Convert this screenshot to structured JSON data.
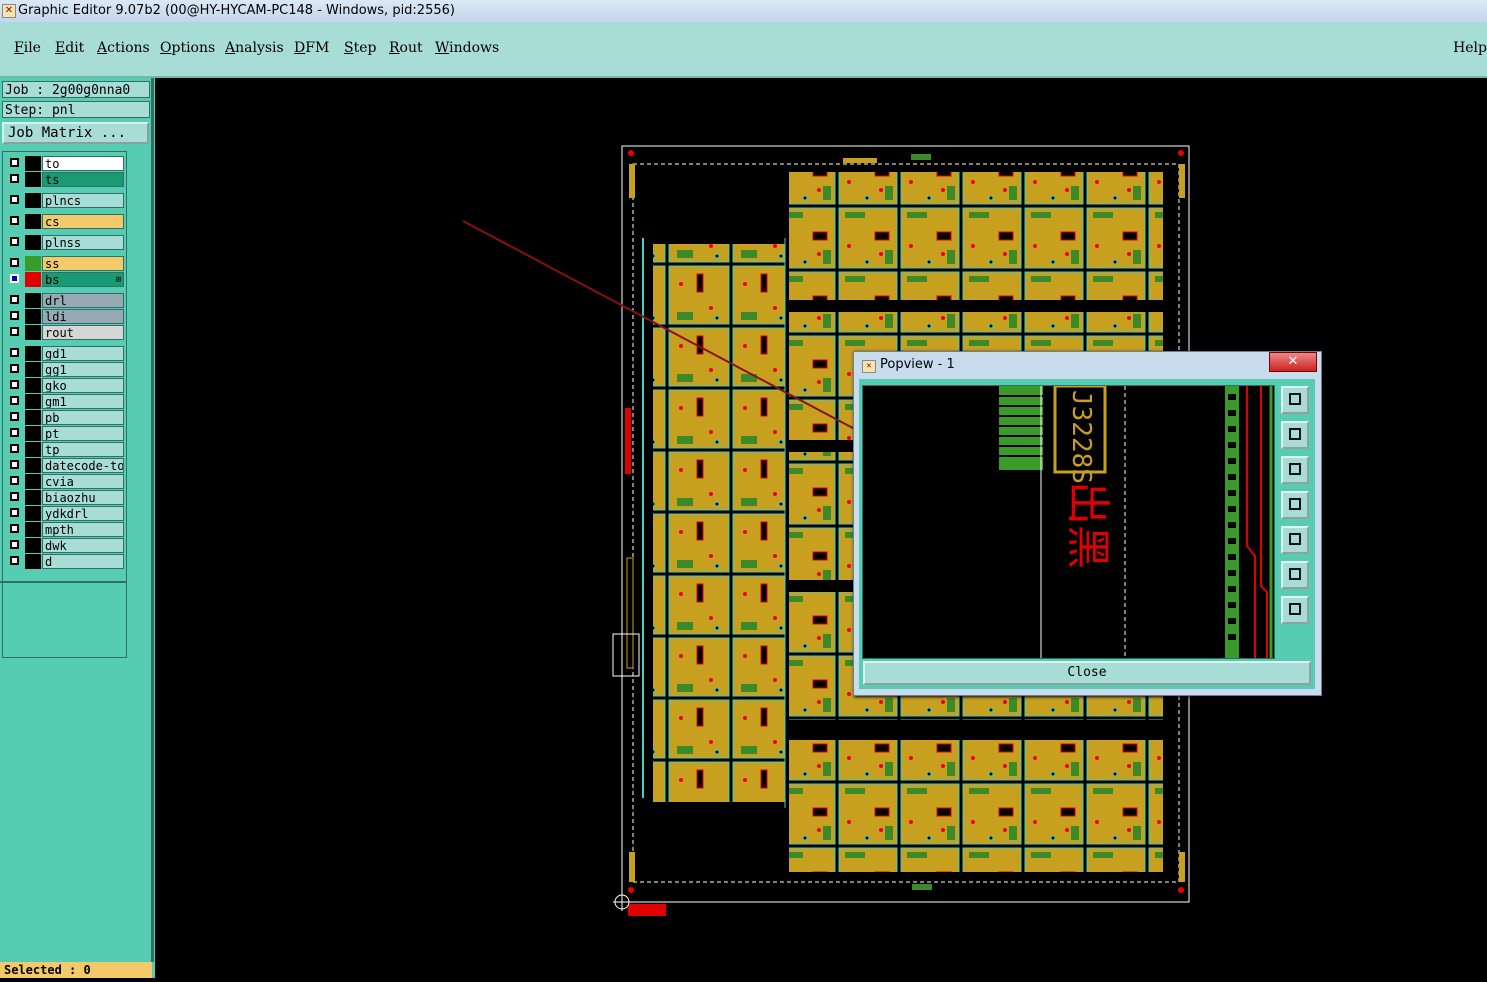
{
  "window": {
    "title": "Graphic Editor 9.07b2 (00@HY-HYCAM-PC148 - Windows, pid:2556)"
  },
  "menu": {
    "items": [
      "File",
      "Edit",
      "Actions",
      "Options",
      "Analysis",
      "DFM",
      "Step",
      "Rout",
      "Windows"
    ],
    "help": "Help"
  },
  "job": {
    "job_line": "Job : 2g00g0nna0",
    "step_line": "Step: pnl",
    "matrix_button": "Job Matrix ..."
  },
  "layers": [
    {
      "name": "to",
      "swatch": "#000000",
      "bg": "#ffffff",
      "checked": false
    },
    {
      "name": "ts",
      "swatch": "#000000",
      "bg": "#1a9a72",
      "checked": false
    },
    {
      "name": "plncs",
      "swatch": "#000000",
      "bg": "#a8dcd6",
      "checked": false
    },
    {
      "name": "cs",
      "swatch": "#000000",
      "bg": "#f3c96a",
      "checked": false
    },
    {
      "name": "plnss",
      "swatch": "#000000",
      "bg": "#a8dcd6",
      "checked": false
    },
    {
      "name": "ss",
      "swatch": "#3a9a2a",
      "bg": "#f3c96a",
      "checked": false
    },
    {
      "name": "bs",
      "swatch": "#e00000",
      "bg": "#1a9a72",
      "checked": true,
      "mark": "⊞"
    },
    {
      "name": "drl",
      "swatch": "#000000",
      "bg": "#97a9b5",
      "checked": false
    },
    {
      "name": "ldi",
      "swatch": "#000000",
      "bg": "#97a9b5",
      "checked": false
    },
    {
      "name": "rout",
      "swatch": "#000000",
      "bg": "#d6d6d6",
      "checked": false
    },
    {
      "name": "gd1",
      "swatch": "#000000",
      "bg": "#a8dcd6",
      "checked": false
    },
    {
      "name": "gg1",
      "swatch": "#000000",
      "bg": "#a8dcd6",
      "checked": false
    },
    {
      "name": "gko",
      "swatch": "#000000",
      "bg": "#a8dcd6",
      "checked": false
    },
    {
      "name": "gm1",
      "swatch": "#000000",
      "bg": "#a8dcd6",
      "checked": false
    },
    {
      "name": "pb",
      "swatch": "#000000",
      "bg": "#a8dcd6",
      "checked": false
    },
    {
      "name": "pt",
      "swatch": "#000000",
      "bg": "#a8dcd6",
      "checked": false
    },
    {
      "name": "tp",
      "swatch": "#000000",
      "bg": "#a8dcd6",
      "checked": false
    },
    {
      "name": "datecode-to",
      "swatch": "#000000",
      "bg": "#a8dcd6",
      "checked": false
    },
    {
      "name": "cvia",
      "swatch": "#000000",
      "bg": "#a8dcd6",
      "checked": false
    },
    {
      "name": "biaozhu",
      "swatch": "#000000",
      "bg": "#a8dcd6",
      "checked": false
    },
    {
      "name": "ydkdrl",
      "swatch": "#000000",
      "bg": "#a8dcd6",
      "checked": false
    },
    {
      "name": "mpth",
      "swatch": "#000000",
      "bg": "#a8dcd6",
      "checked": false
    },
    {
      "name": "dwk",
      "swatch": "#000000",
      "bg": "#a8dcd6",
      "checked": false
    },
    {
      "name": "d",
      "swatch": "#000000",
      "bg": "#a8dcd6",
      "checked": false
    }
  ],
  "status": {
    "selected": "Selected : 0"
  },
  "popview": {
    "title": "Popview - 1",
    "close_x": "✕",
    "close_button": "Close",
    "marking_text": "J3228S",
    "marking_chars": "出黑"
  },
  "colors": {
    "panel": "#56ccb2",
    "board": "#c8a020",
    "outline": "#40d0c0"
  }
}
